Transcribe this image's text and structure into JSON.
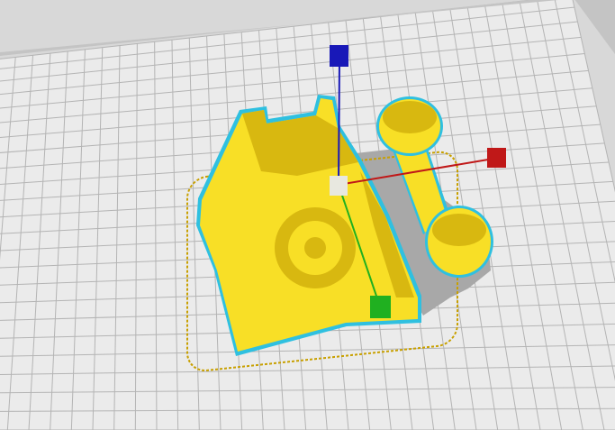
{
  "viewport": {
    "name": "3d-build-plate-view",
    "colors": {
      "background": "#d8d8d8",
      "plate": "#ebebeb",
      "grid_line": "#b4b4b4",
      "plate_border": "#c4c4c4",
      "model_fill": "#f8df26",
      "model_shade": "#d8b810",
      "model_outline": "#2fc0e0",
      "shadow": "#a8a8a8",
      "footprint": "#c8a000",
      "axis_x": "#c01818",
      "axis_y": "#20b020",
      "axis_z": "#1818b8",
      "gizmo_center": "#e8e8e0"
    }
  },
  "model": {
    "name": "rotary-telephone"
  },
  "gizmo": {
    "handles": [
      "x-axis-handle",
      "y-axis-handle",
      "z-axis-handle",
      "center-handle"
    ]
  }
}
